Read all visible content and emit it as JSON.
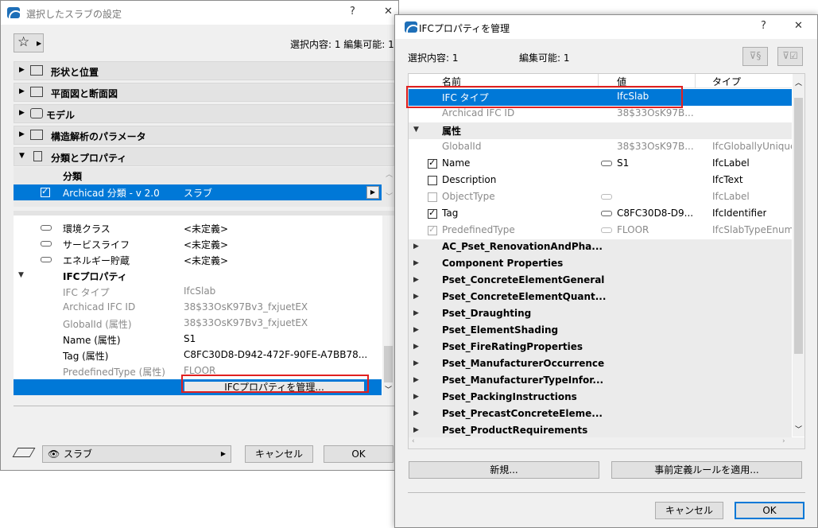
{
  "left": {
    "title": "選択したスラブの設定",
    "help": "?",
    "close": "✕",
    "selection_info": "選択内容: 1 編集可能: 1",
    "sections": [
      {
        "label": "形状と位置"
      },
      {
        "label": "平面図と断面図"
      },
      {
        "label": "モデル"
      },
      {
        "label": "構造解析のパラメータ"
      },
      {
        "label": "分類とプロパティ"
      }
    ],
    "classification_header": "分類",
    "classification_row": {
      "system": "Archicad 分類 - v 2.0",
      "value": "スラブ"
    },
    "props": [
      {
        "name": "環境クラス",
        "value": "<未定義>"
      },
      {
        "name": "サービスライフ",
        "value": "<未定義>"
      },
      {
        "name": "エネルギー貯蔵",
        "value": "<未定義>"
      }
    ],
    "ifc_group": "IFCプロパティ",
    "ifc_rows": [
      {
        "name": "IFC タイプ",
        "value": "IfcSlab"
      },
      {
        "name": "Archicad IFC ID",
        "value": "38$33OsK97Bv3_fxjuetEX"
      },
      {
        "name": "GlobalId (属性)",
        "value": "38$33OsK97Bv3_fxjuetEX"
      },
      {
        "name": "Name (属性)",
        "value": "S1"
      },
      {
        "name": "Tag (属性)",
        "value": "C8FC30D8-D942-472F-90FE-A7BB78..."
      },
      {
        "name": "PredefinedType (属性)",
        "value": "FLOOR"
      }
    ],
    "manage_button": "IFCプロパティを管理...",
    "layer_select": "スラブ",
    "cancel": "キャンセル",
    "ok": "OK"
  },
  "right": {
    "title": "IFCプロパティを管理",
    "help": "?",
    "close": "✕",
    "selection": "選択内容: 1",
    "editable": "編集可能: 1",
    "columns": {
      "name": "名前",
      "value": "値",
      "type": "タイプ"
    },
    "ifc_type_row": {
      "name": "IFC タイプ",
      "value": "IfcSlab"
    },
    "archicad_id_row": {
      "name": "Archicad IFC ID",
      "value": "38$33OsK97B..."
    },
    "attr_group": "属性",
    "attrs": [
      {
        "name": "GlobalId",
        "value": "38$33OsK97B...",
        "type": "IfcGloballyUnique"
      },
      {
        "name": "Name",
        "value": "S1",
        "type": "IfcLabel"
      },
      {
        "name": "Description",
        "value": "",
        "type": "IfcText"
      },
      {
        "name": "ObjectType",
        "value": "",
        "type": "IfcLabel"
      },
      {
        "name": "Tag",
        "value": "C8FC30D8-D9...",
        "type": "IfcIdentifier"
      },
      {
        "name": "PredefinedType",
        "value": "FLOOR",
        "type": "IfcSlabTypeEnum"
      }
    ],
    "psets": [
      "AC_Pset_RenovationAndPha...",
      "Component Properties",
      "Pset_ConcreteElementGeneral",
      "Pset_ConcreteElementQuant...",
      "Pset_Draughting",
      "Pset_ElementShading",
      "Pset_FireRatingProperties",
      "Pset_ManufacturerOccurrence",
      "Pset_ManufacturerTypeInfor...",
      "Pset_PackingInstructions",
      "Pset_PrecastConcreteEleme...",
      "Pset_ProductRequirements"
    ],
    "new_button": "新規...",
    "apply_button": "事前定義ルールを適用...",
    "cancel": "キャンセル",
    "ok": "OK"
  },
  "colors": {
    "selection": "#0078d7",
    "highlight": "#e02020"
  }
}
